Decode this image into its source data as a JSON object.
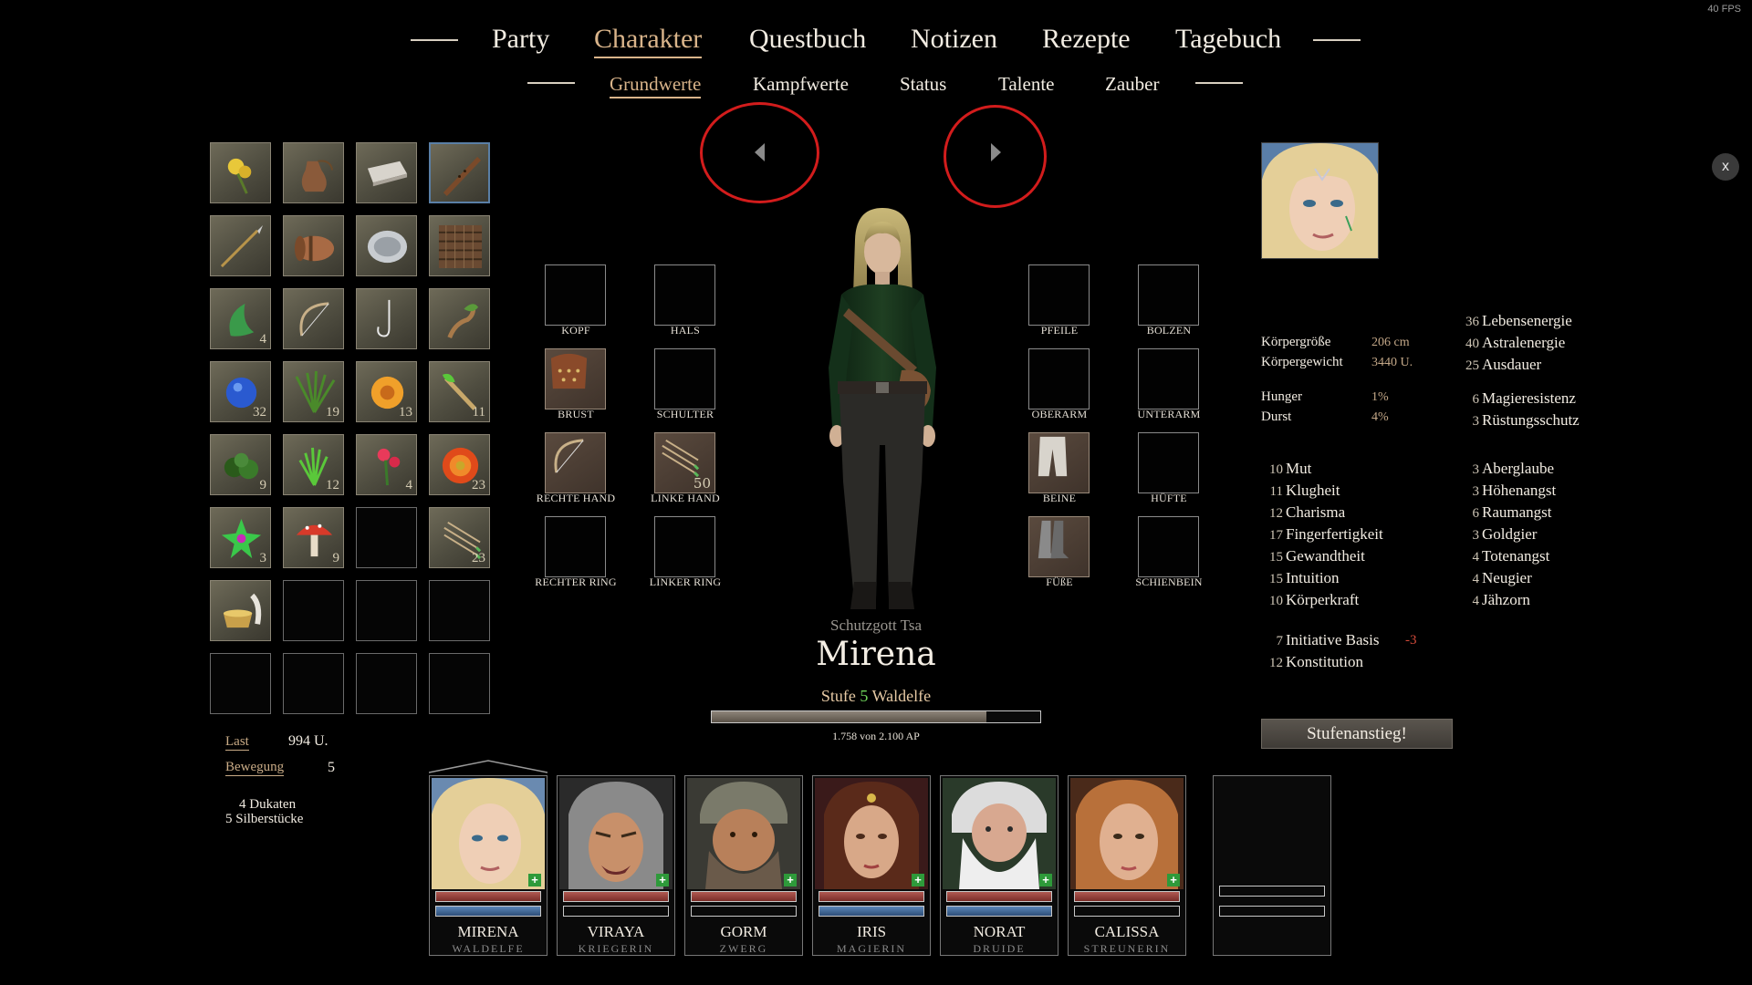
{
  "fps": "40 FPS",
  "nav": {
    "tabs": [
      "Party",
      "Charakter",
      "Questbuch",
      "Notizen",
      "Rezepte",
      "Tagebuch"
    ],
    "active": "Charakter"
  },
  "subnav": {
    "tabs": [
      "Grundwerte",
      "Kampfwerte",
      "Status",
      "Talente",
      "Zauber"
    ],
    "active": "Grundwerte"
  },
  "inventory": [
    {
      "icon": "yellow-flower-icon",
      "qty": ""
    },
    {
      "icon": "waterskin-icon",
      "qty": ""
    },
    {
      "icon": "blanket-icon",
      "qty": ""
    },
    {
      "icon": "flute-icon",
      "qty": "",
      "selected": true
    },
    {
      "icon": "spear-icon",
      "qty": ""
    },
    {
      "icon": "bedroll-icon",
      "qty": ""
    },
    {
      "icon": "plate-icon",
      "qty": ""
    },
    {
      "icon": "chainmail-icon",
      "qty": ""
    },
    {
      "icon": "green-herb-icon",
      "qty": "4"
    },
    {
      "icon": "bow-icon",
      "qty": ""
    },
    {
      "icon": "fishing-hook-icon",
      "qty": ""
    },
    {
      "icon": "root-herb-icon",
      "qty": ""
    },
    {
      "icon": "blue-berry-icon",
      "qty": "32"
    },
    {
      "icon": "grass-blade-icon",
      "qty": "19"
    },
    {
      "icon": "orange-flower-icon",
      "qty": "13"
    },
    {
      "icon": "green-root-icon",
      "qty": "11"
    },
    {
      "icon": "green-fruit-icon",
      "qty": "9"
    },
    {
      "icon": "grass-tuft-icon",
      "qty": "12"
    },
    {
      "icon": "red-flower-icon",
      "qty": "4"
    },
    {
      "icon": "red-orange-flower-icon",
      "qty": "23"
    },
    {
      "icon": "green-star-flower-icon",
      "qty": "3"
    },
    {
      "icon": "red-mushroom-icon",
      "qty": "9"
    },
    {
      "icon": "",
      "qty": ""
    },
    {
      "icon": "arrows-icon",
      "qty": "23"
    },
    {
      "icon": "mortar-icon",
      "qty": ""
    },
    {
      "icon": "",
      "qty": ""
    },
    {
      "icon": "",
      "qty": ""
    },
    {
      "icon": "",
      "qty": ""
    },
    {
      "icon": "",
      "qty": ""
    },
    {
      "icon": "",
      "qty": ""
    },
    {
      "icon": "",
      "qty": ""
    },
    {
      "icon": "",
      "qty": ""
    }
  ],
  "load": {
    "last_label": "Last",
    "last_value": "994",
    "last_unit": "U.",
    "move_label": "Bewegung",
    "move_value": "5",
    "money_line1": "4 Dukaten",
    "money_line2": "5 Silberstücke"
  },
  "equipment": {
    "left": [
      {
        "label": "KOPF",
        "icon": ""
      },
      {
        "label": "HALS",
        "icon": ""
      },
      {
        "label": "BRUST",
        "icon": "leather-armor-icon"
      },
      {
        "label": "SCHULTER",
        "icon": ""
      },
      {
        "label": "RECHTE HAND",
        "icon": "bow-icon"
      },
      {
        "label": "LINKE HAND",
        "icon": "arrows-icon",
        "qty": "50"
      },
      {
        "label": "RECHTER RING",
        "icon": ""
      },
      {
        "label": "LINKER RING",
        "icon": ""
      }
    ],
    "right": [
      {
        "label": "PFEILE",
        "icon": ""
      },
      {
        "label": "BOLZEN",
        "icon": ""
      },
      {
        "label": "OBERARM",
        "icon": ""
      },
      {
        "label": "UNTERARM",
        "icon": ""
      },
      {
        "label": "BEINE",
        "icon": "trousers-icon"
      },
      {
        "label": "HÜFTE",
        "icon": ""
      },
      {
        "label": "FÜßE",
        "icon": "boots-icon"
      },
      {
        "label": "SCHIENBEIN",
        "icon": ""
      }
    ]
  },
  "character": {
    "deity": "Schutzgott Tsa",
    "name": "Mirena",
    "level_prefix": "Stufe",
    "level": "5",
    "race": "Waldelfe",
    "xp_text": "1.758 von 2.100 AP",
    "xp_fraction": 0.837
  },
  "body": {
    "height_label": "Körpergröße",
    "height_value": "206 cm",
    "weight_label": "Körpergewicht",
    "weight_value": "3440 U.",
    "hunger_label": "Hunger",
    "hunger_value": "1%",
    "thirst_label": "Durst",
    "thirst_value": "4%"
  },
  "vitals": [
    {
      "num": "36",
      "label": "Lebensenergie"
    },
    {
      "num": "40",
      "label": "Astralenergie"
    },
    {
      "num": "25",
      "label": "Ausdauer"
    }
  ],
  "resist": [
    {
      "num": "6",
      "label": "Magieresistenz"
    },
    {
      "num": "3",
      "label": "Rüstungsschutz"
    }
  ],
  "attributes": [
    {
      "num": "10",
      "label": "Mut"
    },
    {
      "num": "11",
      "label": "Klugheit"
    },
    {
      "num": "12",
      "label": "Charisma"
    },
    {
      "num": "17",
      "label": "Fingerfertigkeit"
    },
    {
      "num": "15",
      "label": "Gewandtheit"
    },
    {
      "num": "15",
      "label": "Intuition"
    },
    {
      "num": "10",
      "label": "Körperkraft"
    }
  ],
  "negatives": [
    {
      "num": "3",
      "label": "Aberglaube"
    },
    {
      "num": "3",
      "label": "Höhenangst"
    },
    {
      "num": "6",
      "label": "Raumangst"
    },
    {
      "num": "3",
      "label": "Goldgier"
    },
    {
      "num": "4",
      "label": "Totenangst"
    },
    {
      "num": "4",
      "label": "Neugier"
    },
    {
      "num": "4",
      "label": "Jähzorn"
    }
  ],
  "derived": {
    "ini_num": "7",
    "ini_label": "Initiative Basis",
    "ini_mod": "-3",
    "ko_num": "12",
    "ko_label": "Konstitution"
  },
  "levelup_label": "Stufenanstieg!",
  "close_label": "x",
  "party": [
    {
      "name": "MIRENA",
      "class": "WALDELFE",
      "face": "blonde-elf-portrait",
      "hp": 1.0,
      "mp": 1.0
    },
    {
      "name": "VIRAYA",
      "class": "KRIEGERIN",
      "face": "helmeted-warrior-portrait",
      "hp": 1.0,
      "mp": 0
    },
    {
      "name": "GORM",
      "class": "ZWERG",
      "face": "dwarf-portrait",
      "hp": 1.0,
      "mp": 0
    },
    {
      "name": "IRIS",
      "class": "MAGIERIN",
      "face": "mage-woman-portrait",
      "hp": 1.0,
      "mp": 1.0
    },
    {
      "name": "NORAT",
      "class": "DRUIDE",
      "face": "bearded-druid-portrait",
      "hp": 1.0,
      "mp": 1.0
    },
    {
      "name": "CALISSA",
      "class": "STREUNERIN",
      "face": "red-haired-woman-portrait",
      "hp": 1.0,
      "mp": 0
    }
  ],
  "colors": {
    "accent": "#d9b48a",
    "hp": "#9a3e38",
    "mp": "#4a72a4",
    "highlight": "#d21c1c",
    "level_green": "#6fd35a",
    "mod_red": "#d24a3a"
  }
}
